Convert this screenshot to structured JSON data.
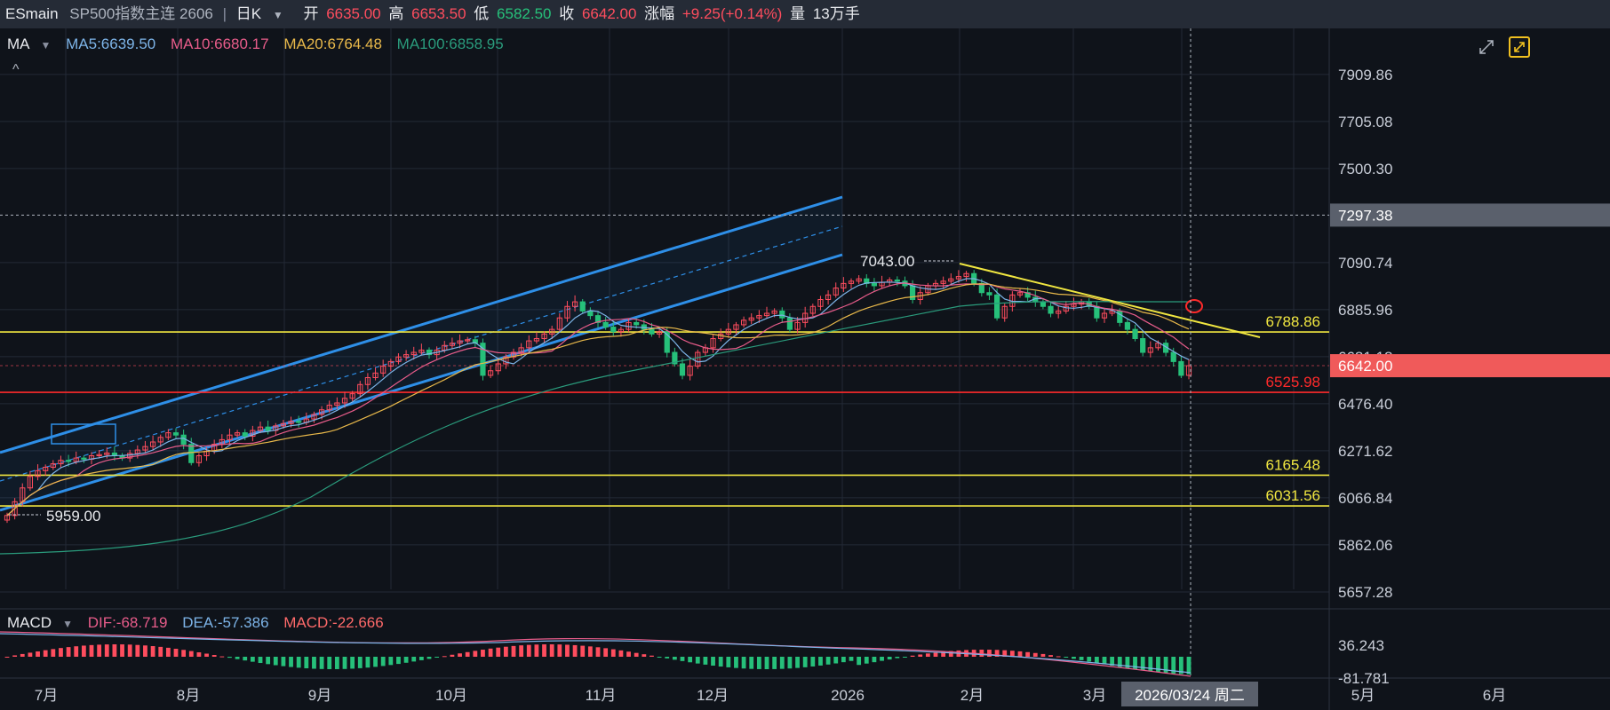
{
  "header": {
    "symbol": "ESmain",
    "name": "SP500指数主连 2606",
    "period": "日K",
    "open_label": "开",
    "open": "6635.00",
    "high_label": "高",
    "high": "6653.50",
    "low_label": "低",
    "low": "6582.50",
    "close_label": "收",
    "close": "6642.00",
    "change_label": "涨幅",
    "change": "+9.25(+0.14%)",
    "volume_label": "量",
    "volume": "13万手"
  },
  "indicators": {
    "main_name": "MA",
    "ma5": "MA5:6639.50",
    "ma10": "MA10:6680.17",
    "ma20": "MA20:6764.48",
    "ma100": "MA100:6858.95",
    "sub_name": "MACD",
    "dif": "DIF:-68.719",
    "dea": "DEA:-57.386",
    "macd": "MACD:-22.666"
  },
  "colors": {
    "ma5": "#7db4e8",
    "ma10": "#e85c8a",
    "ma20": "#e8b84a",
    "ma100": "#2a9b7c",
    "up": "#ff4d5e",
    "down": "#26c07a",
    "channel": "#2e8fe8",
    "yellow": "#f0e640",
    "red_line": "#ff2a2a"
  },
  "chart_data": {
    "type": "candlestick",
    "price_axis": [
      "7909.86",
      "7705.08",
      "7500.30",
      "7090.74",
      "6885.96",
      "6681.18",
      "6476.40",
      "6271.62",
      "6066.84",
      "5862.06",
      "5657.28"
    ],
    "crosshair_price": "7297.38",
    "current_price": "6642.00",
    "date_axis": [
      "7月",
      "8月",
      "9月",
      "10月",
      "11月",
      "12月",
      "2026",
      "2月",
      "3月",
      "5月",
      "6月"
    ],
    "crosshair_date": "2026/03/24 周二",
    "annotations": {
      "high": "7043.00",
      "low": "5959.00"
    },
    "horizontal_levels": [
      {
        "value": 6788.86,
        "label": "6788.86",
        "color": "#f0e640"
      },
      {
        "value": 6525.98,
        "label": "6525.98",
        "color": "#ff2a2a"
      },
      {
        "value": 6165.48,
        "label": "6165.48",
        "color": "#f0e640"
      },
      {
        "value": 6031.56,
        "label": "6031.56",
        "color": "#f0e640"
      }
    ],
    "macd_axis": [
      "36.243",
      "-81.781"
    ],
    "closes": [
      5990,
      6050,
      6110,
      6160,
      6185,
      6200,
      6215,
      6230,
      6225,
      6240,
      6235,
      6250,
      6255,
      6262,
      6250,
      6240,
      6260,
      6275,
      6290,
      6310,
      6330,
      6350,
      6340,
      6300,
      6220,
      6250,
      6270,
      6300,
      6320,
      6340,
      6350,
      6335,
      6360,
      6375,
      6360,
      6380,
      6390,
      6400,
      6395,
      6410,
      6430,
      6450,
      6470,
      6480,
      6500,
      6520,
      6560,
      6590,
      6610,
      6640,
      6660,
      6680,
      6690,
      6700,
      6710,
      6690,
      6710,
      6730,
      6740,
      6750,
      6755,
      6740,
      6600,
      6620,
      6650,
      6680,
      6700,
      6720,
      6750,
      6760,
      6780,
      6800,
      6850,
      6900,
      6920,
      6880,
      6860,
      6830,
      6810,
      6790,
      6800,
      6830,
      6820,
      6800,
      6780,
      6790,
      6700,
      6650,
      6600,
      6640,
      6700,
      6720,
      6760,
      6780,
      6800,
      6820,
      6840,
      6850,
      6860,
      6870,
      6880,
      6850,
      6800,
      6830,
      6870,
      6900,
      6930,
      6950,
      6980,
      7000,
      7010,
      7020,
      7000,
      6990,
      7005,
      7015,
      7010,
      6990,
      6930,
      6960,
      6990,
      7000,
      7010,
      7020,
      7030,
      7043,
      7000,
      6960,
      6950,
      6850,
      6900,
      6950,
      6960,
      6940,
      6920,
      6900,
      6870,
      6880,
      6900,
      6910,
      6920,
      6900,
      6850,
      6870,
      6880,
      6830,
      6800,
      6760,
      6700,
      6720,
      6740,
      6700,
      6660,
      6600,
      6642
    ]
  }
}
